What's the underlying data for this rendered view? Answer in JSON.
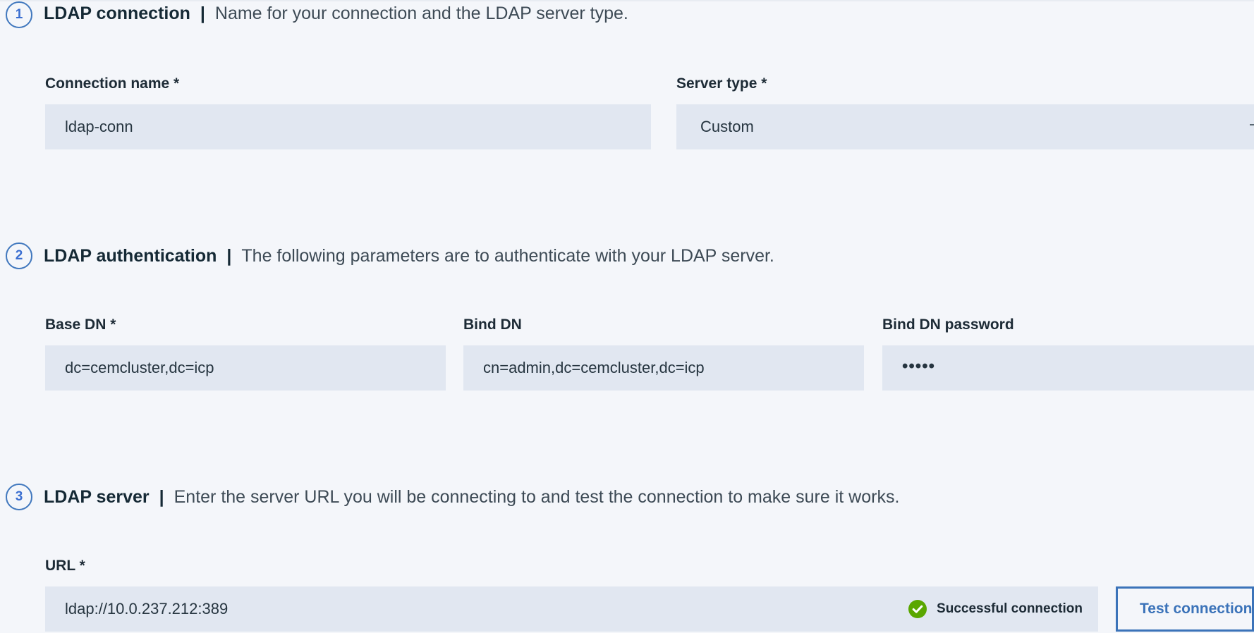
{
  "sections": [
    {
      "number": "1",
      "title": "LDAP connection",
      "separator": "|",
      "description": "Name for your connection and the LDAP server type.",
      "fields": {
        "connection_name": {
          "label": "Connection name *",
          "value": "ldap-conn"
        },
        "server_type": {
          "label": "Server type *",
          "value": "Custom"
        }
      }
    },
    {
      "number": "2",
      "title": "LDAP authentication",
      "separator": "|",
      "description": "The following parameters are to authenticate with your LDAP server.",
      "fields": {
        "base_dn": {
          "label": "Base DN *",
          "value": "dc=cemcluster,dc=icp"
        },
        "bind_dn": {
          "label": "Bind DN",
          "value": "cn=admin,dc=cemcluster,dc=icp"
        },
        "bind_dn_password": {
          "label": "Bind DN password",
          "value": "•••••"
        }
      }
    },
    {
      "number": "3",
      "title": "LDAP server",
      "separator": "|",
      "description": "Enter the server URL you will be connecting to and test the connection to make sure it works.",
      "fields": {
        "url": {
          "label": "URL *",
          "value": "ldap://10.0.237.212:389"
        }
      },
      "status": {
        "text": "Successful connection",
        "icon": "checkmark-circle-icon",
        "color": "#5aa700"
      },
      "test_button": {
        "label": "Test connection"
      }
    }
  ],
  "colors": {
    "accent": "#3b73b9",
    "background": "#f4f6fa",
    "field_background": "#e1e7f1",
    "success": "#5aa700"
  }
}
